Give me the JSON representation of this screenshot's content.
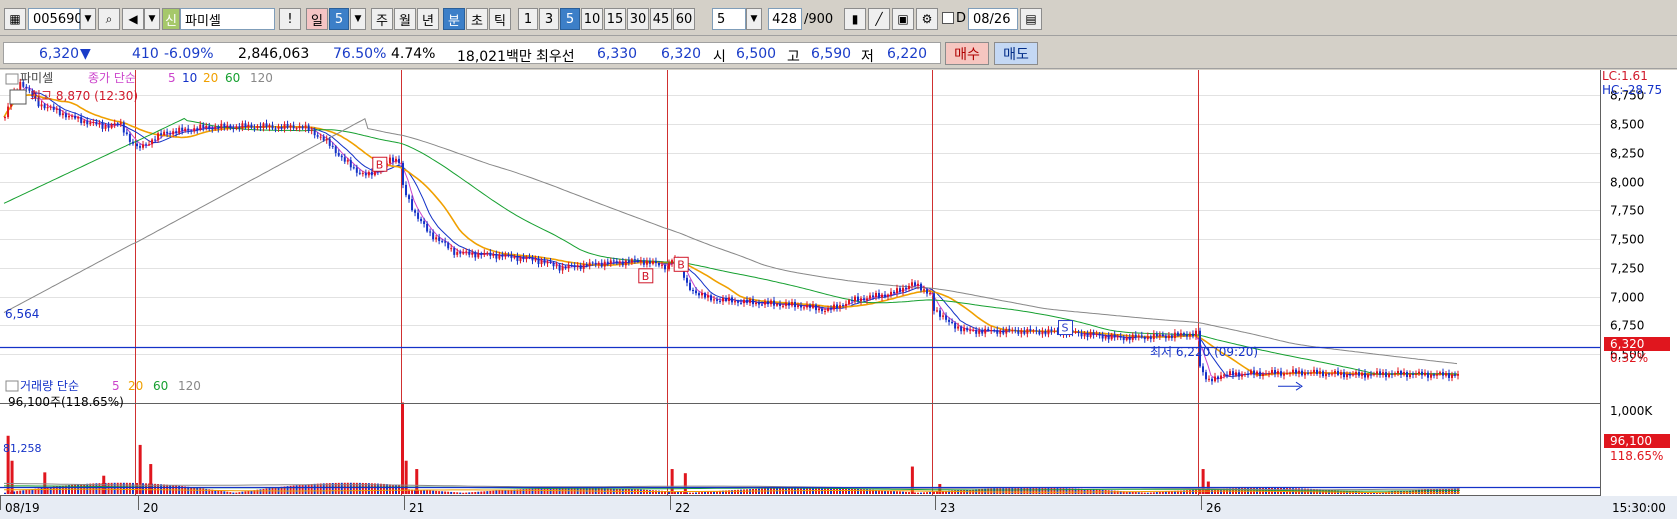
{
  "toolbar": {
    "code": "005690",
    "badge": "신",
    "name": "파미셀",
    "alert": "!",
    "day": "일",
    "day_n": "5",
    "week": "주",
    "month": "월",
    "year": "년",
    "minute": "분",
    "second": "초",
    "tick": "틱",
    "intervals": [
      "1",
      "3",
      "5",
      "10",
      "15",
      "30",
      "45",
      "60"
    ],
    "interval_value": "5",
    "count": "428",
    "count_total": "/900",
    "d_label": "D",
    "date": "08/26"
  },
  "info": {
    "price": "6,320",
    "down_arrow": "▼",
    "change": "410",
    "change_pct": "-6.09%",
    "volume": "2,846,063",
    "volume_ratio": "76.50%",
    "turnover": "4.74%",
    "amount": "18,021백만",
    "best_label": "최우선",
    "best_ask": "6,330",
    "best_bid": "6,320",
    "open_label": "시",
    "open": "6,500",
    "high_label": "고",
    "high": "6,590",
    "low_label": "저",
    "low": "6,220",
    "buy_label": "매수",
    "sell_label": "매도"
  },
  "colors": {
    "up": "#e0161e",
    "down": "#1432c8",
    "ma5": "#cc44cc",
    "ma10": "#1432c8",
    "ma20": "#f0a000",
    "ma60": "#16a030",
    "ma120": "#888888"
  },
  "chart_data": [
    {
      "type": "candlestick",
      "name": "파미셀",
      "legend_label": "종가 단순",
      "ma_periods": [
        "5",
        "10",
        "20",
        "60",
        "120"
      ],
      "x_ticks": [
        "08/19",
        "20",
        "21",
        "22",
        "23",
        "26"
      ],
      "y_ticks": [
        "8,750",
        "8,500",
        "8,250",
        "8,000",
        "7,750",
        "7,500",
        "7,250",
        "7,000",
        "6,750",
        "6,500"
      ],
      "ylim": [
        6100,
        8900
      ],
      "hline": {
        "value": 6564,
        "label": "6,564"
      },
      "max_annotation": "최고 8,870 (12:30)",
      "min_annotation": "최저 6,220 (09:20)",
      "signals": [
        {
          "day": 1,
          "frac": 0.92,
          "label": "B",
          "price": 8150
        },
        {
          "day": 2,
          "frac": 0.92,
          "label": "B",
          "price": 7180
        },
        {
          "day": 3,
          "frac": 0.05,
          "label": "B",
          "price": 7280
        },
        {
          "day": 4,
          "frac": 0.5,
          "label": "S",
          "price": 6730
        }
      ],
      "lc": "LC:1.61",
      "hc": "HC:-28.75",
      "last_price": "6,320",
      "last_pct": "0.32%",
      "days": [
        {
          "start": 8560,
          "points": [
            [
              0,
              8560
            ],
            [
              0.05,
              8720
            ],
            [
              0.12,
              8870
            ],
            [
              0.25,
              8680
            ],
            [
              0.38,
              8620
            ],
            [
              0.5,
              8560
            ],
            [
              0.62,
              8520
            ],
            [
              0.75,
              8480
            ],
            [
              0.88,
              8500
            ],
            [
              1,
              8280
            ]
          ]
        },
        {
          "start": 8280,
          "points": [
            [
              0,
              8280
            ],
            [
              0.1,
              8420
            ],
            [
              0.25,
              8470
            ],
            [
              0.45,
              8480
            ],
            [
              0.55,
              8470
            ],
            [
              0.62,
              8480
            ],
            [
              0.7,
              8380
            ],
            [
              0.82,
              8100
            ],
            [
              0.88,
              8050
            ],
            [
              0.95,
              8180
            ],
            [
              1,
              8180
            ]
          ]
        },
        {
          "start": 8180,
          "points": [
            [
              0,
              7950
            ],
            [
              0.05,
              7700
            ],
            [
              0.1,
              7550
            ],
            [
              0.2,
              7380
            ],
            [
              0.35,
              7360
            ],
            [
              0.5,
              7320
            ],
            [
              0.6,
              7250
            ],
            [
              0.75,
              7290
            ],
            [
              0.9,
              7310
            ],
            [
              1,
              7260
            ]
          ]
        },
        {
          "start": 7260,
          "points": [
            [
              0,
              7300
            ],
            [
              0.03,
              7350
            ],
            [
              0.07,
              7080
            ],
            [
              0.15,
              6980
            ],
            [
              0.3,
              6950
            ],
            [
              0.5,
              6920
            ],
            [
              0.6,
              6880
            ],
            [
              0.7,
              6970
            ],
            [
              0.85,
              7030
            ],
            [
              0.92,
              7110
            ],
            [
              1,
              7020
            ]
          ]
        },
        {
          "start": 7020,
          "points": [
            [
              0,
              6900
            ],
            [
              0.05,
              6780
            ],
            [
              0.12,
              6700
            ],
            [
              0.3,
              6700
            ],
            [
              0.5,
              6690
            ],
            [
              0.7,
              6640
            ],
            [
              0.9,
              6660
            ],
            [
              1,
              6680
            ]
          ]
        },
        {
          "start": 6680,
          "points": [
            [
              0,
              6400
            ],
            [
              0.03,
              6250
            ],
            [
              0.08,
              6320
            ],
            [
              0.2,
              6330
            ],
            [
              0.4,
              6340
            ],
            [
              0.6,
              6320
            ],
            [
              0.75,
              6330
            ],
            [
              0.9,
              6320
            ],
            [
              1,
              6320
            ]
          ]
        }
      ]
    },
    {
      "type": "bar",
      "name": "거래량",
      "legend_label": "거래량 단순",
      "ma_periods": [
        "5",
        "20",
        "60",
        "120"
      ],
      "annotation": "96,100주(118.65%)",
      "ref_label": "81,258",
      "y_ticks": [
        "1,000K"
      ],
      "ylim": [
        0,
        1250000
      ],
      "last_value": "96,100",
      "last_pct": "118.65%",
      "spikes": [
        {
          "day": 0,
          "frac": 0.02,
          "value": 700000
        },
        {
          "day": 0,
          "frac": 0.05,
          "value": 400000
        },
        {
          "day": 0,
          "frac": 0.3,
          "value": 260000
        },
        {
          "day": 0,
          "frac": 0.75,
          "value": 220000
        },
        {
          "day": 1,
          "frac": 0.01,
          "value": 590000
        },
        {
          "day": 1,
          "frac": 0.05,
          "value": 360000
        },
        {
          "day": 1,
          "frac": 1.0,
          "value": 1100000
        },
        {
          "day": 2,
          "frac": 0.01,
          "value": 400000
        },
        {
          "day": 2,
          "frac": 0.05,
          "value": 300000
        },
        {
          "day": 3,
          "frac": 0.01,
          "value": 300000
        },
        {
          "day": 3,
          "frac": 0.06,
          "value": 250000
        },
        {
          "day": 3,
          "frac": 0.92,
          "value": 330000
        },
        {
          "day": 4,
          "frac": 0.02,
          "value": 120000
        },
        {
          "day": 5,
          "frac": 0.01,
          "value": 300000
        },
        {
          "day": 5,
          "frac": 0.03,
          "value": 150000
        }
      ]
    }
  ],
  "time_label": "15:30:00"
}
